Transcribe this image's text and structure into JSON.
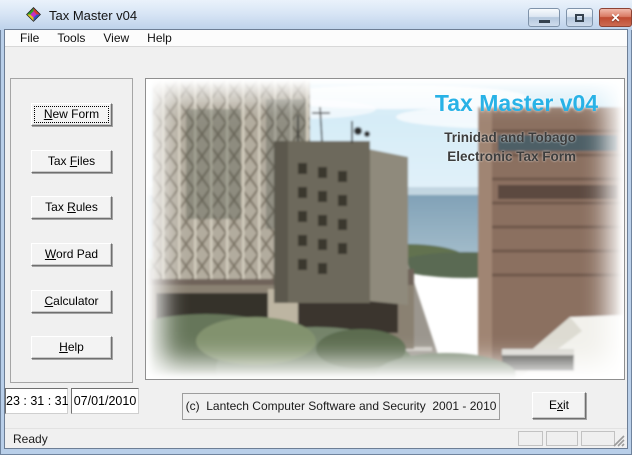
{
  "window": {
    "title": "Tax Master v04"
  },
  "icons": {
    "app": "gem-app-icon",
    "minimize": "minimize-icon",
    "maximize": "maximize-icon",
    "close": "close-icon",
    "resize_grip": "resize-grip-icon"
  },
  "menu": {
    "items": [
      {
        "label": "File"
      },
      {
        "label": "Tools"
      },
      {
        "label": "View"
      },
      {
        "label": "Help"
      }
    ]
  },
  "sidebar": {
    "buttons": [
      {
        "pre": "",
        "key": "N",
        "post": "ew Form"
      },
      {
        "pre": "Tax ",
        "key": "F",
        "post": "iles"
      },
      {
        "pre": "Tax ",
        "key": "R",
        "post": "ules"
      },
      {
        "pre": "",
        "key": "W",
        "post": "ord Pad"
      },
      {
        "pre": "",
        "key": "C",
        "post": "alculator"
      },
      {
        "pre": "",
        "key": "H",
        "post": "elp"
      }
    ]
  },
  "hero": {
    "title": "Tax Master v04",
    "subtitle1": "Trinidad and Tobago",
    "subtitle2": "Electronic Tax Form"
  },
  "footer": {
    "time": "23 : 31 : 31",
    "date": "07/01/2010",
    "copyright": "(c)  Lantech Computer Software and Security  2001 - 2010",
    "exit": {
      "pre": "E",
      "key": "x",
      "post": "it"
    }
  },
  "statusbar": {
    "text": "Ready"
  },
  "colors": {
    "brand_cyan": "#29b2e6",
    "subtitle_gray": "#3d3d3d",
    "close_red": "#c4513d",
    "titlebar_blue": "#bdd2eb",
    "client_gray": "#f0f0f0"
  }
}
